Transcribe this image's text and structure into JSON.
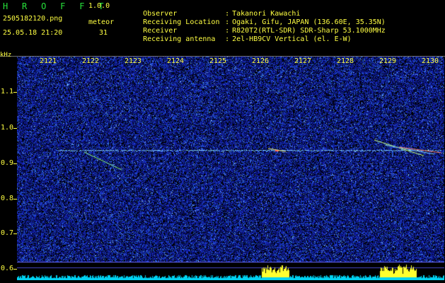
{
  "header": {
    "logo": "H R O F F T",
    "version": "1.0.0",
    "filename": "2505182120.png",
    "datetime": "25.05.18 21:20",
    "mode_label": "meteor",
    "meteor_count": "31"
  },
  "info": {
    "separator": ":",
    "rows": [
      {
        "key": "Observer",
        "value": "Takanori Kawachi"
      },
      {
        "key": "Receiving Location",
        "value": "Ogaki, Gifu, JAPAN (136.60E, 35.35N)"
      },
      {
        "key": "Receiver",
        "value": "R820T2(RTL-SDR) SDR-Sharp 53.1000MHz"
      },
      {
        "key": "Receiving antenna",
        "value": "2el-HB9CV Vertical (el. E-W)"
      }
    ]
  },
  "axes": {
    "y_unit": "kHz",
    "time_ticks": [
      "2121",
      "2122",
      "2123",
      "2124",
      "2125",
      "2126",
      "2127",
      "2128",
      "2129",
      "2130"
    ],
    "freq_ticks": [
      "1.1",
      "1.0",
      "0.9",
      "0.8",
      "0.7",
      "0.6"
    ]
  },
  "colors": {
    "text": "#ffff42",
    "logo": "#27e23b",
    "background_noise": "#1a2a9a",
    "carrier": "#7fd0ff",
    "level_bars": "#00d2f0",
    "level_peaks": "#ffff30"
  },
  "icons": {
    "logo": "hrofft-logo"
  }
}
